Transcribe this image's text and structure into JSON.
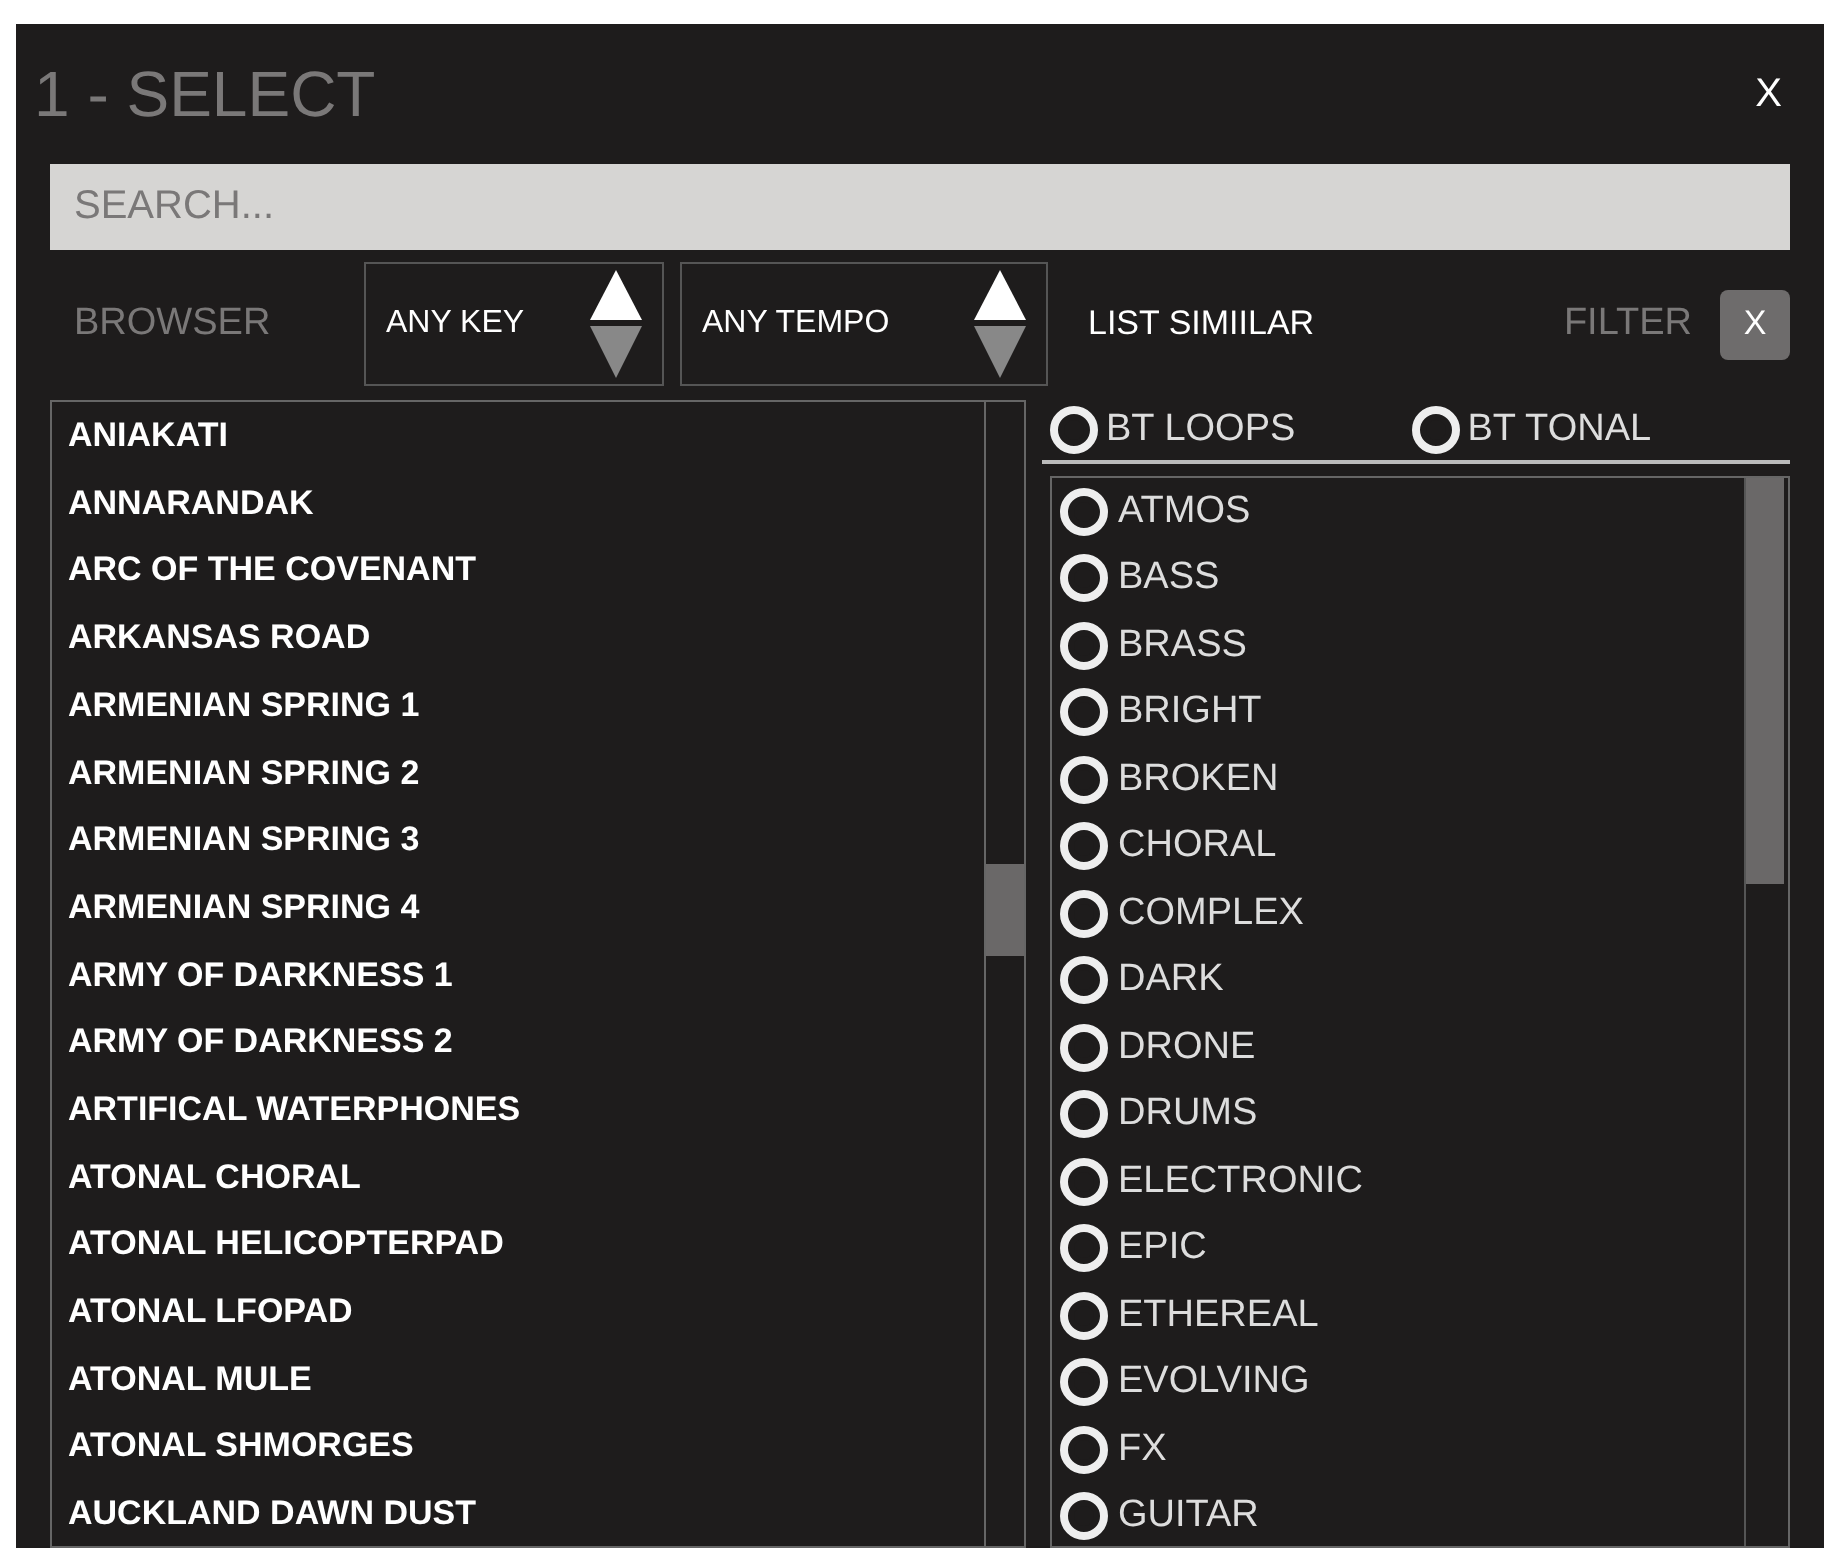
{
  "window": {
    "title": "1 - SELECT",
    "close": "X"
  },
  "search": {
    "placeholder": "SEARCH..."
  },
  "toolbar": {
    "browser_label": "BROWSER",
    "key_select": "ANY KEY",
    "tempo_select": "ANY TEMPO",
    "list_similar": "LIST SIMIILAR",
    "filter_label": "FILTER",
    "filter_clear": "X"
  },
  "presets": [
    "ANIAKATI",
    "ANNARANDAK",
    "ARC OF THE COVENANT",
    "ARKANSAS ROAD",
    "ARMENIAN SPRING 1",
    "ARMENIAN SPRING 2",
    "ARMENIAN SPRING 3",
    "ARMENIAN SPRING 4",
    "ARMY OF DARKNESS 1",
    "ARMY OF DARKNESS 2",
    "ARTIFICAL WATERPHONES",
    "ATONAL CHORAL",
    "ATONAL HELICOPTERPAD",
    "ATONAL LFOPAD",
    "ATONAL MULE",
    "ATONAL SHMORGES",
    "AUCKLAND DAWN DUST"
  ],
  "libraries": [
    {
      "label": "BT LOOPS",
      "selected": false
    },
    {
      "label": "BT TONAL",
      "selected": false
    }
  ],
  "tags": [
    {
      "label": "ATMOS",
      "selected": false
    },
    {
      "label": "BASS",
      "selected": false
    },
    {
      "label": "BRASS",
      "selected": false
    },
    {
      "label": "BRIGHT",
      "selected": false
    },
    {
      "label": "BROKEN",
      "selected": false
    },
    {
      "label": "CHORAL",
      "selected": false
    },
    {
      "label": "COMPLEX",
      "selected": false
    },
    {
      "label": "DARK",
      "selected": false
    },
    {
      "label": "DRONE",
      "selected": false
    },
    {
      "label": "DRUMS",
      "selected": false
    },
    {
      "label": "ELECTRONIC",
      "selected": false
    },
    {
      "label": "EPIC",
      "selected": false
    },
    {
      "label": "ETHEREAL",
      "selected": false
    },
    {
      "label": "EVOLVING",
      "selected": false
    },
    {
      "label": "FX",
      "selected": false
    },
    {
      "label": "GUITAR",
      "selected": false
    }
  ]
}
